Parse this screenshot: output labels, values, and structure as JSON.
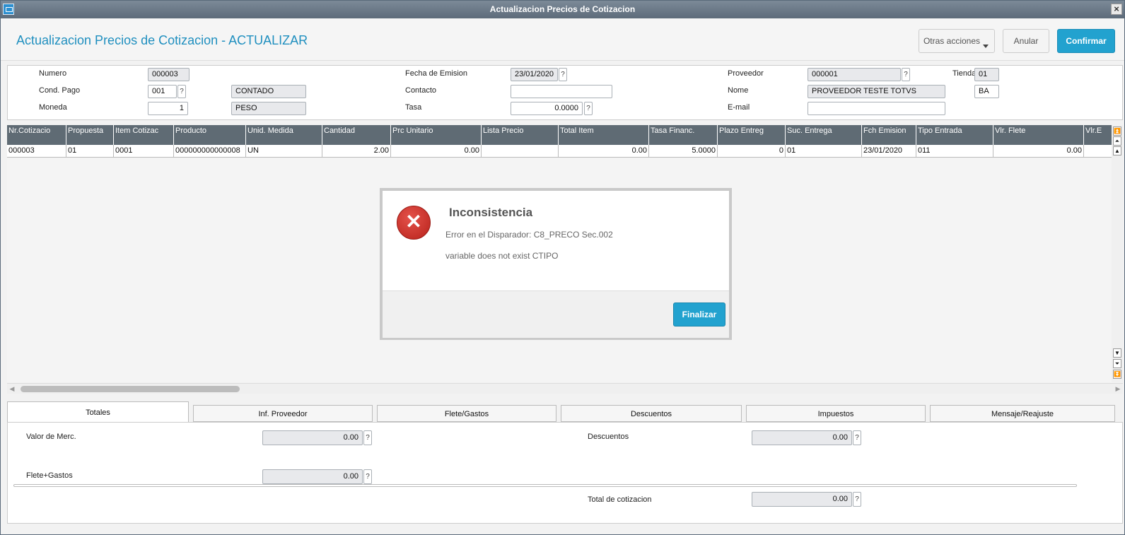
{
  "window": {
    "title": "Actualizacion Precios de Cotizacion"
  },
  "header": {
    "page_title": "Actualizacion Precios de Cotizacion - ACTUALIZAR",
    "other_actions": "Otras acciones",
    "cancel": "Anular",
    "confirm": "Confirmar"
  },
  "form": {
    "numero": {
      "label": "Numero",
      "value": "000003"
    },
    "cond_pago": {
      "label": "Cond. Pago",
      "code": "001",
      "desc": "CONTADO"
    },
    "moneda": {
      "label": "Moneda",
      "value": "1",
      "desc": "PESO"
    },
    "fecha_emision": {
      "label": "Fecha de Emision",
      "value": "23/01/2020"
    },
    "contacto": {
      "label": "Contacto",
      "value": ""
    },
    "tasa": {
      "label": "Tasa",
      "value": "0.0000"
    },
    "proveedor": {
      "label": "Proveedor",
      "value": "000001"
    },
    "tienda": {
      "label": "Tienda",
      "value": "01"
    },
    "nome": {
      "label": "Nome",
      "value": "PROVEEDOR TESTE TOTVS",
      "state": "BA"
    },
    "email": {
      "label": "E-mail",
      "value": ""
    },
    "help_glyph": "?"
  },
  "grid": {
    "headers": [
      "Nr.Cotizacio",
      "Propuesta",
      "Item Cotizac",
      "Producto",
      "Unid. Medida",
      "Cantidad",
      "Prc Unitario",
      "Lista Precio",
      "Total Item",
      "Tasa Financ.",
      "Plazo Entreg",
      "Suc. Entrega",
      "Fch Emision",
      "Tipo Entrada",
      "Vlr. Flete",
      "Vlr.E"
    ],
    "rows": [
      [
        "000003",
        "01",
        "0001",
        "000000000000008",
        "UN",
        "2.00",
        "0.00",
        "",
        "0.00",
        "5.0000",
        "0",
        "01",
        "23/01/2020",
        "011",
        "0.00",
        ""
      ]
    ]
  },
  "tabs": [
    "Totales",
    "Inf. Proveedor",
    "Flete/Gastos",
    "Descuentos",
    "Impuestos",
    "Mensaje/Reajuste"
  ],
  "totales": {
    "valor_merc": {
      "label": "Valor de Merc.",
      "value": "0.00"
    },
    "descuentos": {
      "label": "Descuentos",
      "value": "0.00"
    },
    "flete_gastos": {
      "label": "Flete+Gastos",
      "value": "0.00"
    },
    "total_cotizacion": {
      "label": "Total de cotizacion",
      "value": "0.00"
    }
  },
  "dialog": {
    "title": "Inconsistencia",
    "message_line1": "Error en el Disparador: C8_PRECO Sec.002",
    "message_line2": "variable does not exist CTIPO",
    "button": "Finalizar",
    "icon": "error-x-icon"
  }
}
